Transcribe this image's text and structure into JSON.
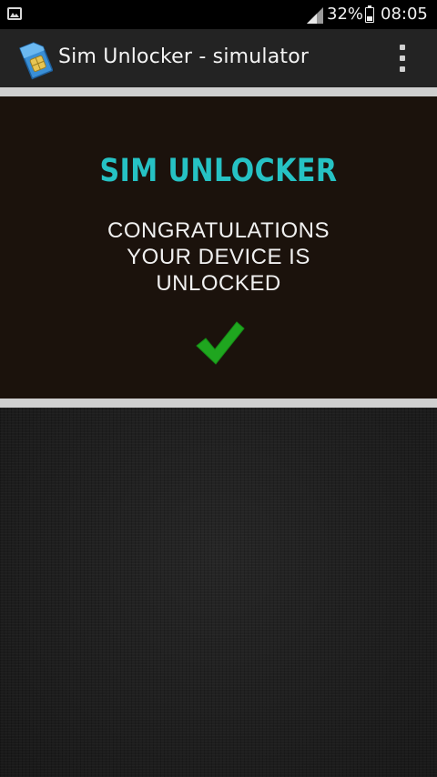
{
  "status_bar": {
    "battery_percent": "32%",
    "time": "08:05",
    "icons": [
      "gallery-icon",
      "signal-icon",
      "battery-icon"
    ]
  },
  "action_bar": {
    "title": "Sim Unlocker - simulator",
    "app_icon": "sim-card-icon",
    "menu_icon": "overflow-menu-icon"
  },
  "result": {
    "heading": "SIM UNLOCKER",
    "message_lines": [
      "CONGRATULATIONS",
      "YOUR DEVICE IS",
      "UNLOCKED"
    ],
    "icon": "checkmark-icon"
  },
  "colors": {
    "heading": "#26c2c4",
    "checkmark": "#1fa61f",
    "panel_bg": "#1b120c",
    "action_bar_bg": "#232323"
  }
}
